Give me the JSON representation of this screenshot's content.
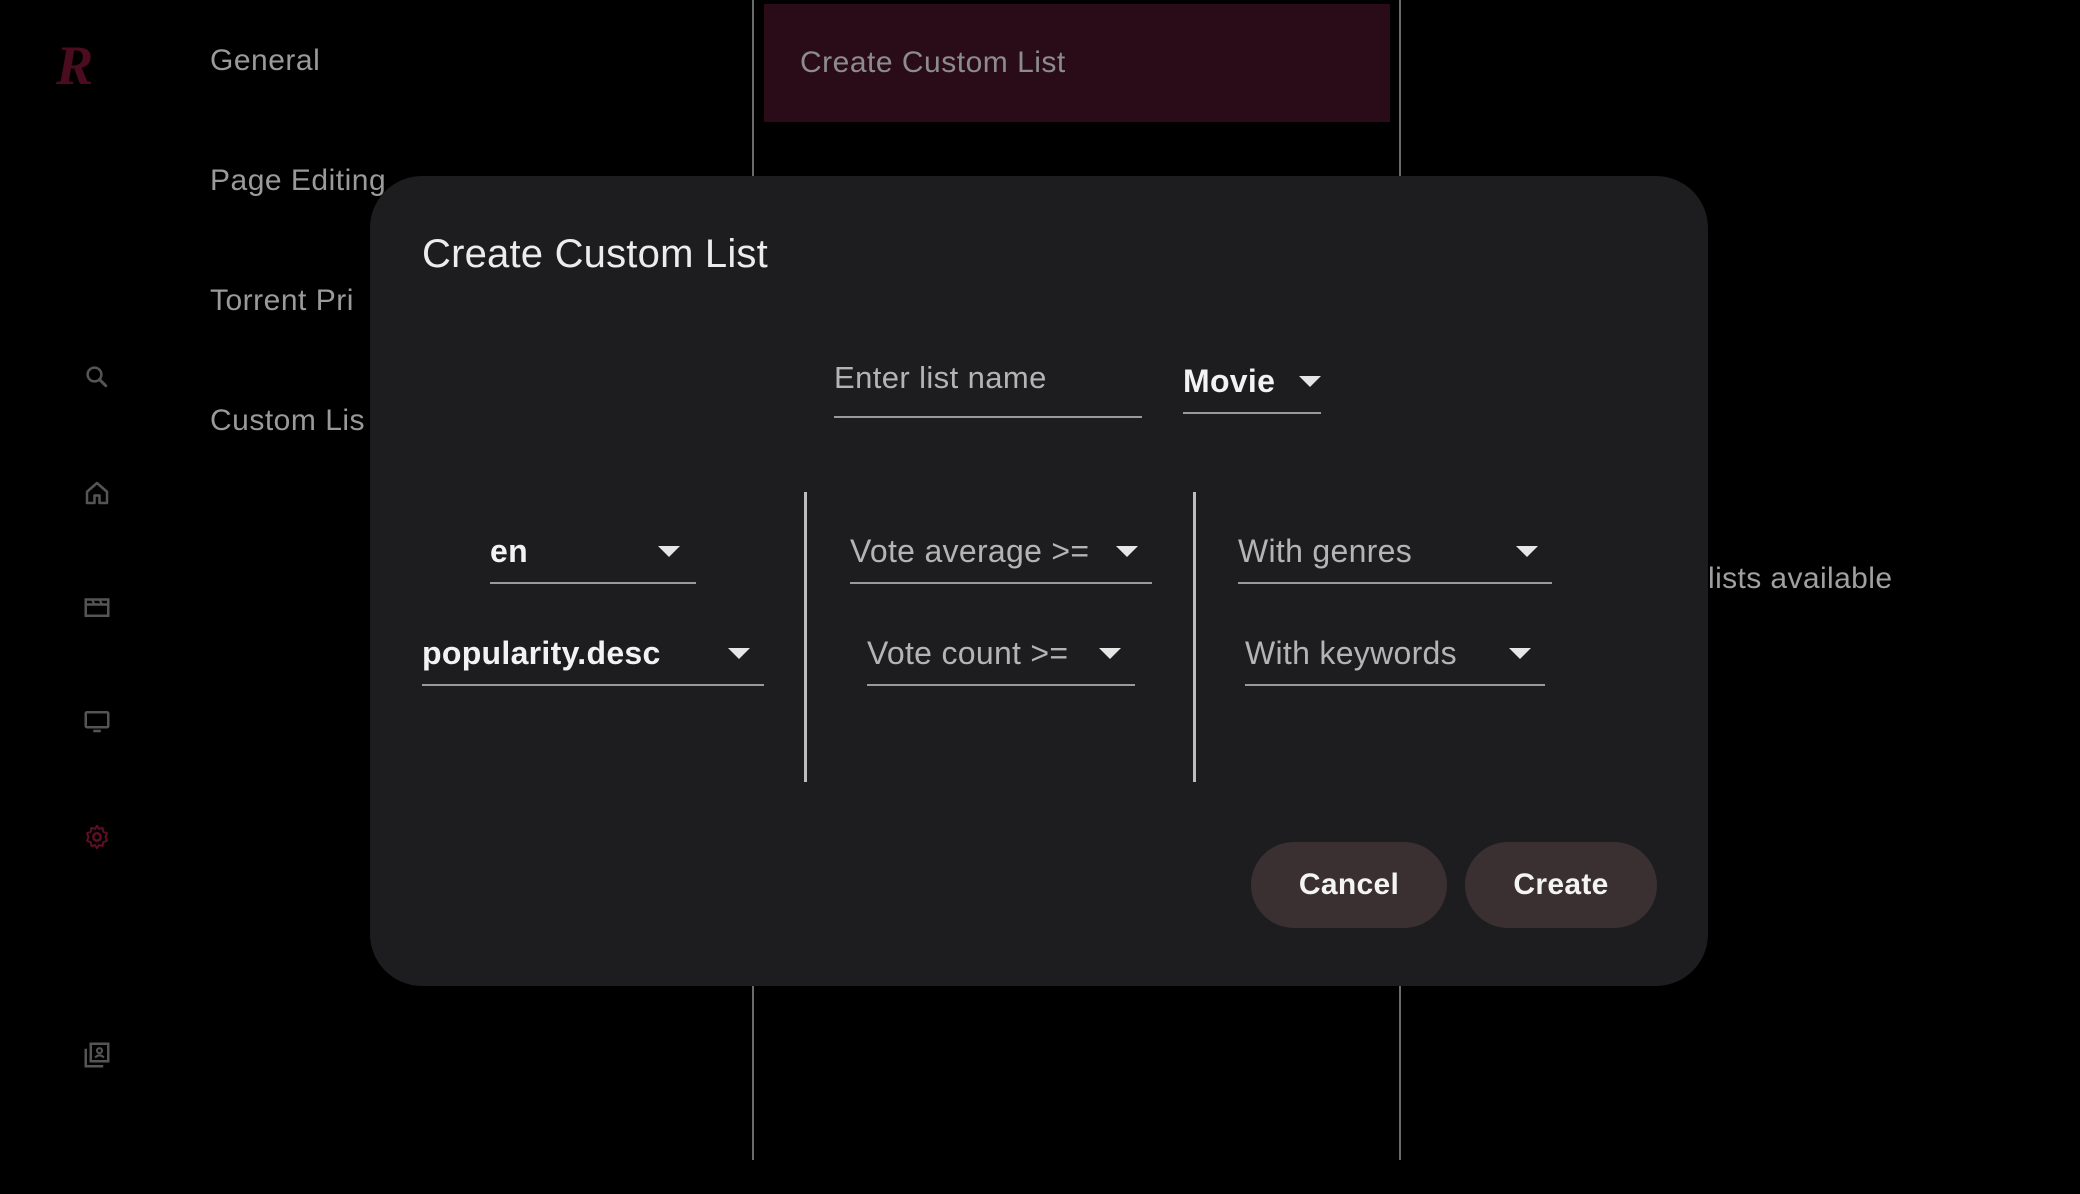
{
  "rail": {
    "logo_letter": "R",
    "accent_color": "#5e0f26",
    "icons": [
      "search-icon",
      "home-icon",
      "movie-icon",
      "tv-icon",
      "settings-icon",
      "library-icon"
    ]
  },
  "settings_nav": {
    "items": [
      {
        "label": "General"
      },
      {
        "label": "Page Editing"
      },
      {
        "label": "Torrent Pri"
      },
      {
        "label": "Custom Lis"
      }
    ]
  },
  "background": {
    "create_button_label": "Create Custom List",
    "empty_text": "lists available"
  },
  "dialog": {
    "title": "Create Custom List",
    "list_name": {
      "value": "",
      "placeholder": "Enter list name"
    },
    "media_type": "Movie",
    "language": "en",
    "sort_by": "popularity.desc",
    "vote_average_hint": "Vote average >=",
    "vote_count_hint": "Vote count >=",
    "genres_hint": "With genres",
    "keywords_hint": "With keywords",
    "cancel_label": "Cancel",
    "create_label": "Create"
  }
}
